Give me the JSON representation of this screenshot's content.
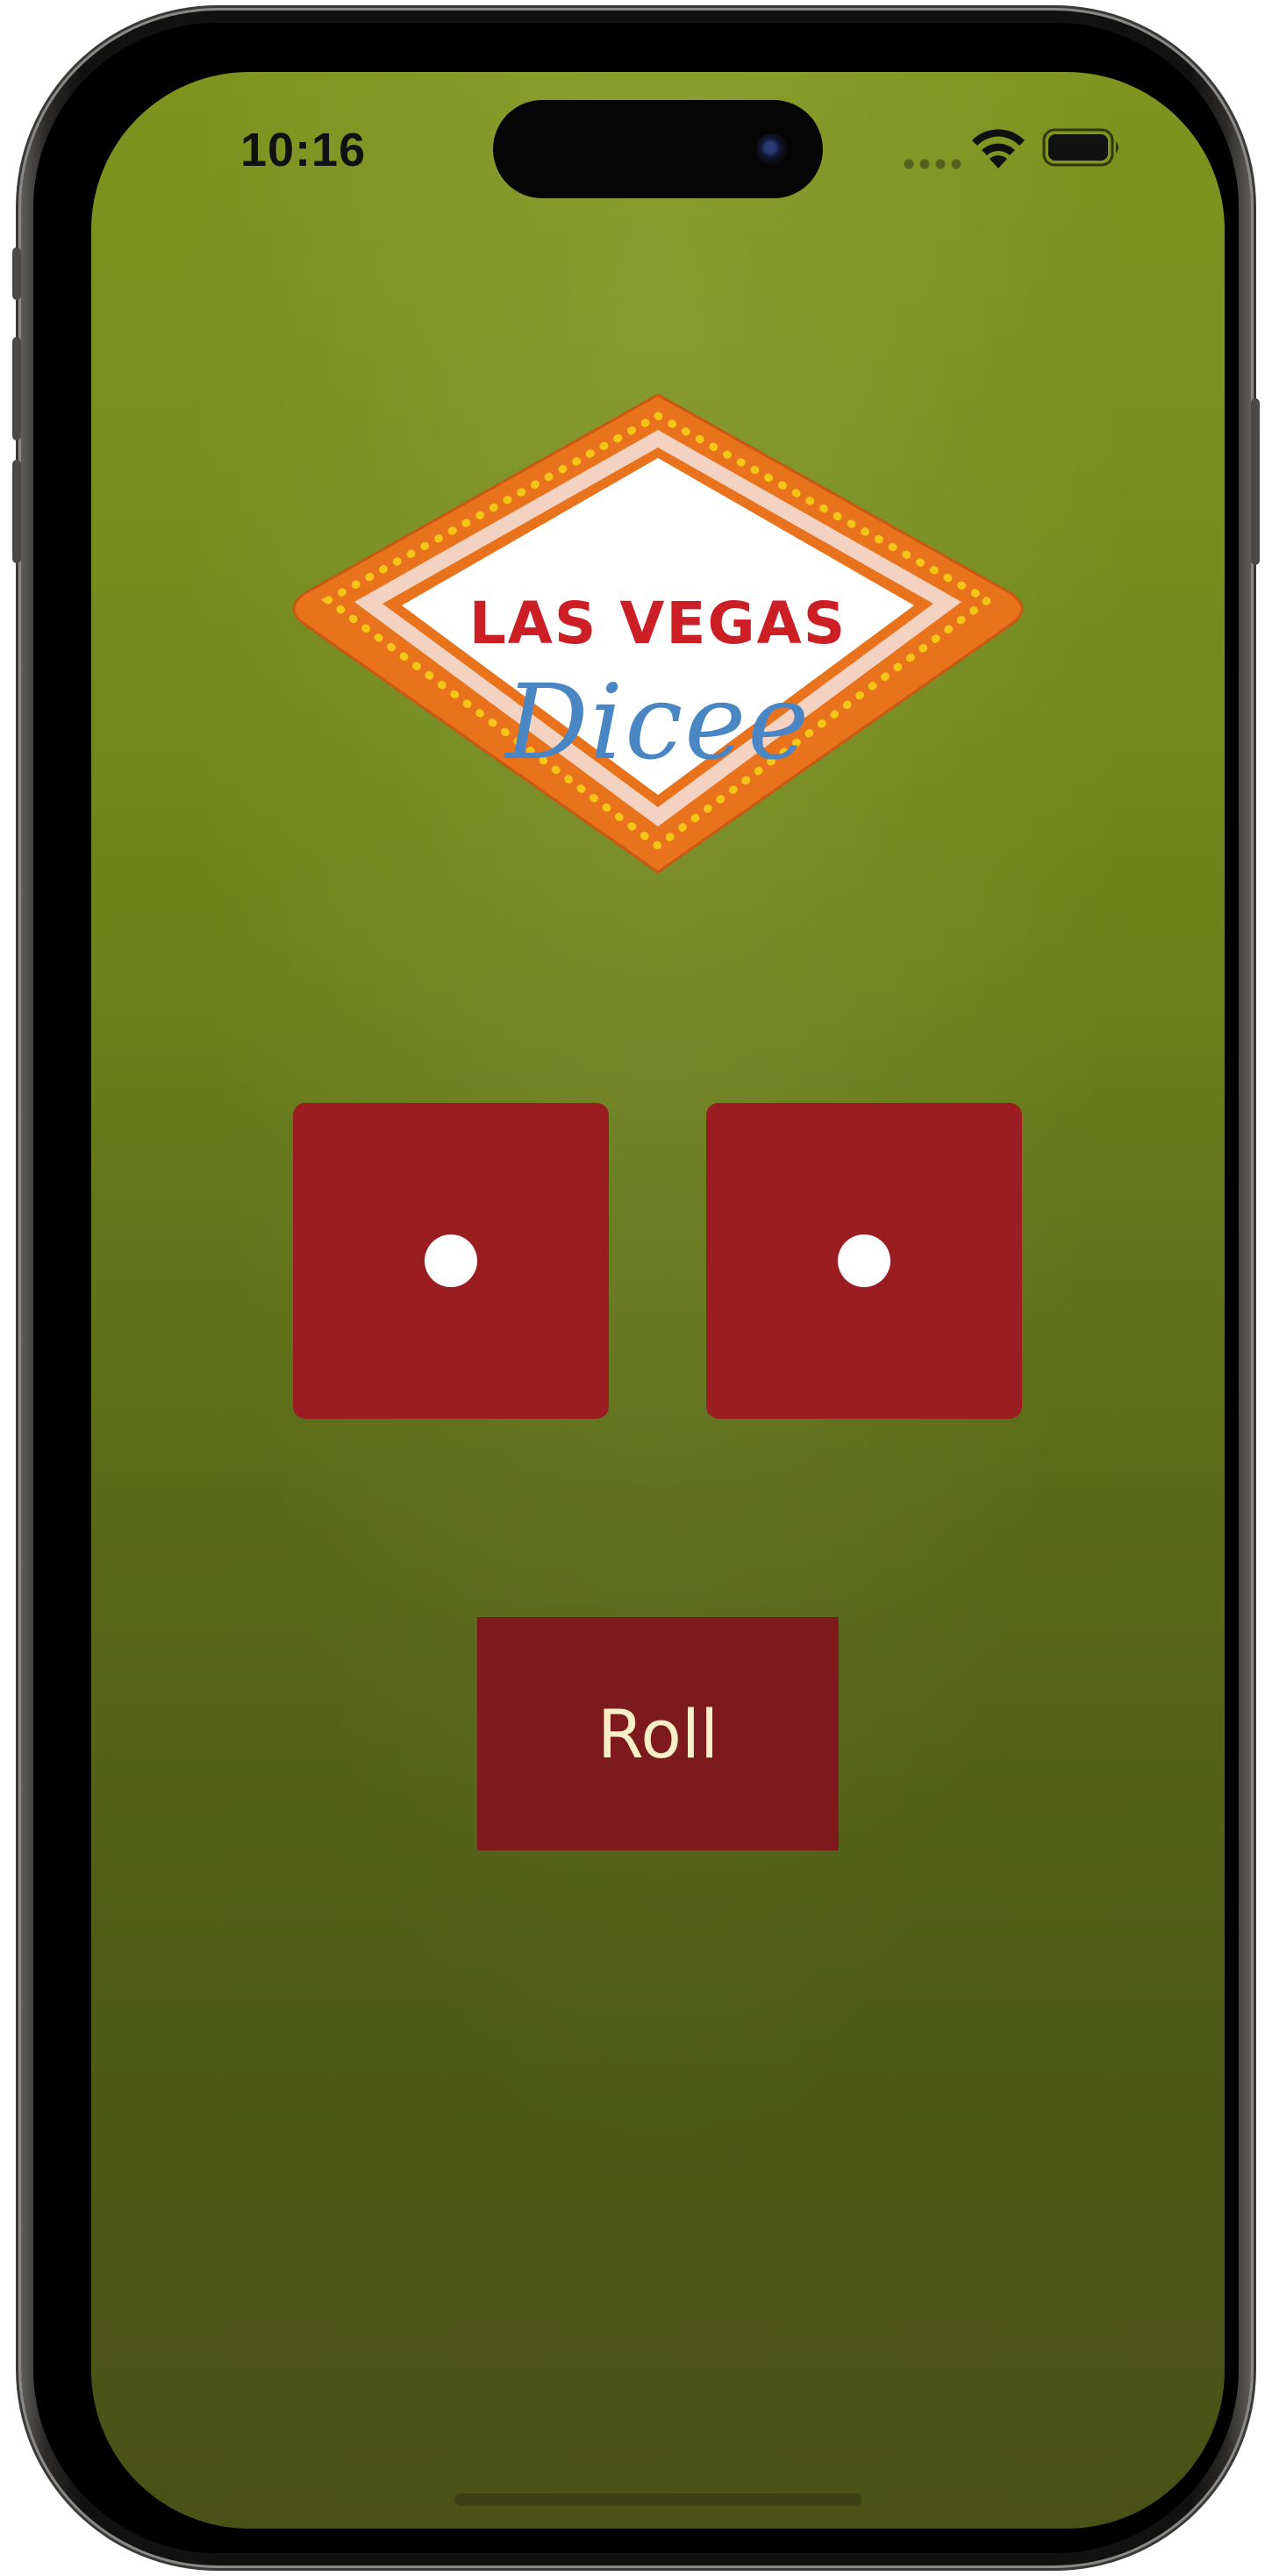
{
  "status_bar": {
    "time": "10:16",
    "wifi_icon": "wifi-icon",
    "battery_icon": "battery-icon"
  },
  "logo": {
    "line1": "LAS VEGAS",
    "line2": "Dicee"
  },
  "dice": [
    {
      "value": 1
    },
    {
      "value": 1
    }
  ],
  "roll_button": {
    "label": "Roll"
  },
  "colors": {
    "felt_top": "#7e941f",
    "felt_bottom": "#4a5217",
    "die": "#9a1d21",
    "button": "#7c1a1d",
    "button_text": "#f6efc8",
    "logo_red": "#cc1e25",
    "logo_blue": "#4a86c4",
    "sign_orange": "#e8731c",
    "bulb_yellow": "#f5c518"
  }
}
